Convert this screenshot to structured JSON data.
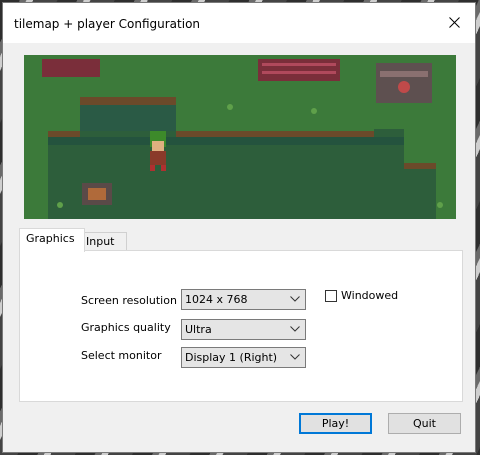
{
  "window": {
    "title": "tilemap + player Configuration"
  },
  "tabs": [
    {
      "label": "Graphics"
    },
    {
      "label": "Input"
    }
  ],
  "graphics": {
    "resolution_label": "Screen resolution",
    "resolution_value": "1024 x 768",
    "quality_label": "Graphics quality",
    "quality_value": "Ultra",
    "monitor_label": "Select monitor",
    "monitor_value": "Display 1 (Right)",
    "windowed_label": "Windowed",
    "windowed_checked": false
  },
  "buttons": {
    "play": "Play!",
    "quit": "Quit"
  },
  "colors": {
    "accent": "#0078d7",
    "grass": "#3c7a3a",
    "water": "#2d5e3b"
  },
  "icons": [
    "close-icon",
    "chevron-down-icon"
  ]
}
